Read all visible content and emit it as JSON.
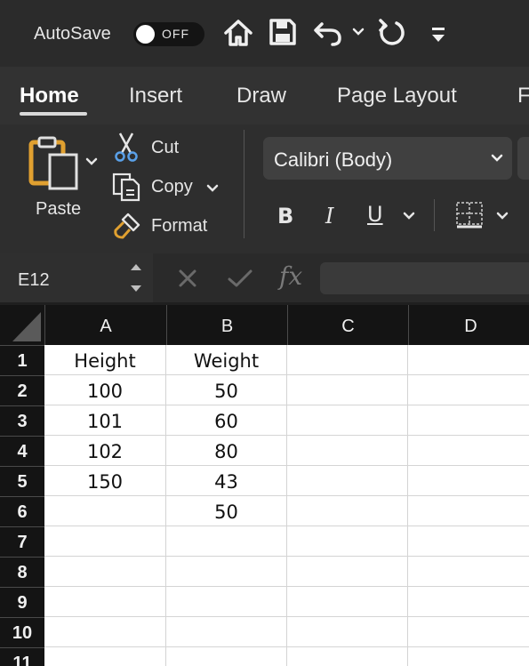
{
  "titlebar": {
    "autosave_label": "AutoSave",
    "toggle_state": "OFF"
  },
  "tabs": [
    {
      "label": "Home",
      "active": true
    },
    {
      "label": "Insert"
    },
    {
      "label": "Draw"
    },
    {
      "label": "Page Layout"
    },
    {
      "label": "F"
    }
  ],
  "ribbon": {
    "paste_label": "Paste",
    "cut_label": "Cut",
    "copy_label": "Copy",
    "format_label": "Format",
    "font_name": "Calibri (Body)"
  },
  "formula_bar": {
    "cell_ref": "E12",
    "fx_label": "fx",
    "formula": ""
  },
  "sheet": {
    "columns": [
      "A",
      "B",
      "C",
      "D"
    ],
    "rows": [
      {
        "num": "1",
        "cells": [
          "Height",
          "Weight",
          "",
          ""
        ]
      },
      {
        "num": "2",
        "cells": [
          "100",
          "50",
          "",
          ""
        ]
      },
      {
        "num": "3",
        "cells": [
          "101",
          "60",
          "",
          ""
        ]
      },
      {
        "num": "4",
        "cells": [
          "102",
          "80",
          "",
          ""
        ]
      },
      {
        "num": "5",
        "cells": [
          "150",
          "43",
          "",
          ""
        ]
      },
      {
        "num": "6",
        "cells": [
          "",
          "50",
          "",
          ""
        ]
      },
      {
        "num": "7",
        "cells": [
          "",
          "",
          "",
          ""
        ]
      },
      {
        "num": "8",
        "cells": [
          "",
          "",
          "",
          ""
        ]
      },
      {
        "num": "9",
        "cells": [
          "",
          "",
          "",
          ""
        ]
      },
      {
        "num": "10",
        "cells": [
          "",
          "",
          "",
          ""
        ]
      },
      {
        "num": "11",
        "cells": [
          "",
          "",
          "",
          ""
        ]
      }
    ]
  }
}
